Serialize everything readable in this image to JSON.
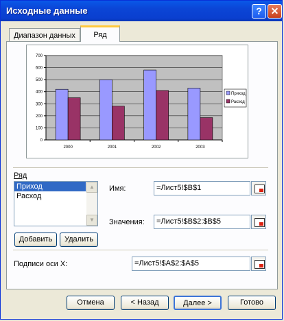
{
  "window": {
    "title": "Исходные данные",
    "help_glyph": "?",
    "close_glyph": "✕"
  },
  "tabs": [
    {
      "label": "Диапазон данных"
    },
    {
      "label": "Ряд",
      "active": true
    }
  ],
  "chart_data": {
    "type": "bar",
    "categories": [
      "2000",
      "2001",
      "2002",
      "2003"
    ],
    "series": [
      {
        "name": "Приход",
        "values": [
          420,
          500,
          580,
          430
        ],
        "color": "#9999ff"
      },
      {
        "name": "Расход",
        "values": [
          350,
          280,
          410,
          185
        ],
        "color": "#993366"
      }
    ],
    "yticks": [
      "0",
      "100",
      "200",
      "300",
      "400",
      "500",
      "600",
      "700"
    ],
    "ylim": [
      0,
      700
    ],
    "grid": true,
    "legend": "right",
    "plot_bg": "#c0c0c0"
  },
  "series_section": {
    "label": "Ряд",
    "items": [
      "Приход",
      "Расход"
    ],
    "selected": 0,
    "add_button": "Добавить",
    "remove_button": "Удалить"
  },
  "name_field": {
    "label": "Имя:",
    "value": "=Лист5!$B$1"
  },
  "values_field": {
    "label": "Значения:",
    "value": "=Лист5!$B$2:$B$5"
  },
  "xaxis_field": {
    "label": "Подписи оси X:",
    "value": "=Лист5!$A$2:$A$5"
  },
  "buttons": {
    "cancel": "Отмена",
    "back": "< Назад",
    "next": "Далее >",
    "finish": "Готово"
  }
}
